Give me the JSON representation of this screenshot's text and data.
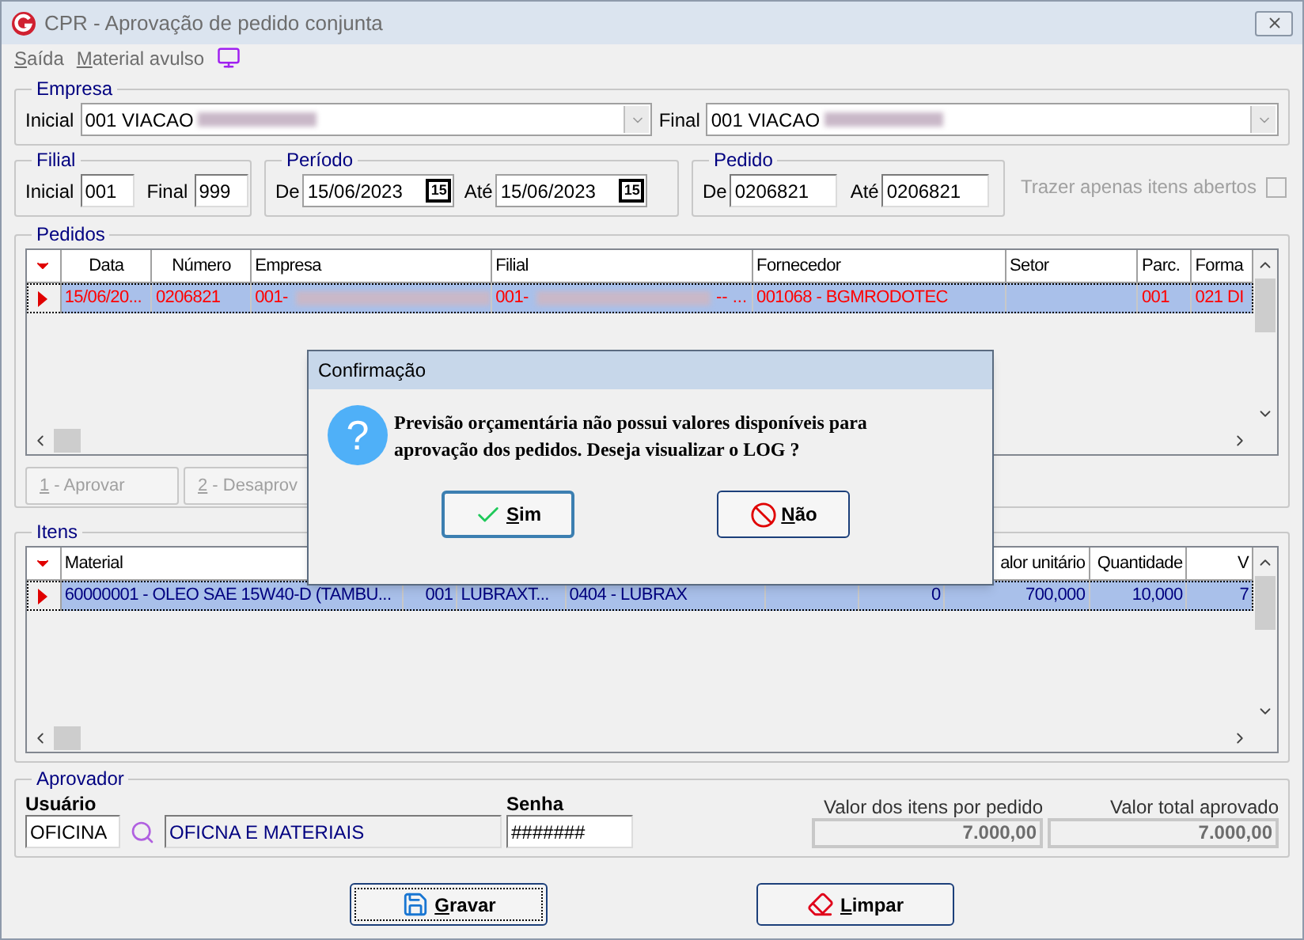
{
  "window": {
    "title": "CPR - Aprovação de pedido conjunta"
  },
  "menu": [
    {
      "label": "Saída"
    },
    {
      "label": "Material avulso"
    }
  ],
  "empresa": {
    "title": "Empresa",
    "fields": [
      {
        "label": "Inicial",
        "value": "001 VIACAO"
      },
      {
        "label": "Final",
        "value": "001 VIACAO"
      }
    ]
  },
  "filial": {
    "title": "Filial",
    "fields": [
      {
        "label": "Inicial",
        "value": "001"
      },
      {
        "label": "Final",
        "value": "999"
      }
    ]
  },
  "periodo": {
    "title": "Período",
    "fields": [
      {
        "label": "De",
        "value": "15/06/2023",
        "button": "15"
      },
      {
        "label": "Até",
        "value": "15/06/2023",
        "button": "15"
      }
    ]
  },
  "pedido": {
    "title": "Pedido",
    "fields": [
      {
        "label": "De",
        "value": "0206821"
      },
      {
        "label": "Até",
        "value": "0206821"
      }
    ]
  },
  "open_items_only": {
    "label": "Trazer apenas itens abertos",
    "checked": false,
    "disabled": true
  },
  "pedidos": {
    "title": "Pedidos",
    "columns": [
      "Data",
      "Número",
      "Empresa",
      "Filial",
      "Fornecedor",
      "Setor",
      "Parc.",
      "Forma"
    ],
    "rows": [
      {
        "selected": true,
        "cells": [
          {
            "text": "15/06/20..."
          },
          {
            "text": "0206821"
          },
          {
            "text": "001-",
            "redacted": true
          },
          {
            "text": "001-",
            "redacted": true,
            "after": "-- ..."
          },
          {
            "text": "001068 - BGMRODOTEC"
          },
          null,
          {
            "text": "001"
          },
          {
            "text": "021  DI"
          }
        ]
      }
    ],
    "buttons": [
      {
        "label": "1 - Aprovar",
        "disabled": true
      },
      {
        "label": "2 - Desaprov",
        "disabled": true
      }
    ]
  },
  "itens": {
    "title": "Itens",
    "columns": [
      "Material",
      null,
      null,
      null,
      null,
      null,
      "alor unitário",
      "Quantidade",
      "V"
    ],
    "rows": [
      {
        "selected": true,
        "cells": [
          {
            "text": "60000001 - OLEO SAE 15W40-D (TAMBU..."
          },
          {
            "text": "001"
          },
          {
            "text": "LUBRAXT..."
          },
          {
            "text": "0404 - LUBRAX"
          },
          null,
          {
            "text": "0"
          },
          {
            "text": "700,000"
          },
          {
            "text": "10,000"
          },
          {
            "text": "7"
          }
        ]
      }
    ]
  },
  "aprovador": {
    "title": "Aprovador",
    "user_label": "Usuário",
    "user_value": "OFICINA",
    "user_name": "OFICNA E MATERIAIS",
    "password_label": "Senha",
    "password_value": "#######"
  },
  "totals": [
    {
      "label": "Valor dos itens por pedido",
      "value": "7.000,00"
    },
    {
      "label": "Valor total aprovado",
      "value": "7.000,00"
    }
  ],
  "actions": [
    {
      "label": "Gravar",
      "kind": "save"
    },
    {
      "label": "Limpar",
      "kind": "clear"
    }
  ],
  "dialog": {
    "title": "Confirmação",
    "glyph": "?",
    "message": "Previsão orçamentária não possui valores disponíveis para aprovação dos pedidos. Deseja visualizar o LOG ?",
    "buttons": [
      {
        "label": "Sim",
        "kind": "yes",
        "focused": true
      },
      {
        "label": "Não",
        "kind": "no",
        "focused": false
      }
    ]
  }
}
